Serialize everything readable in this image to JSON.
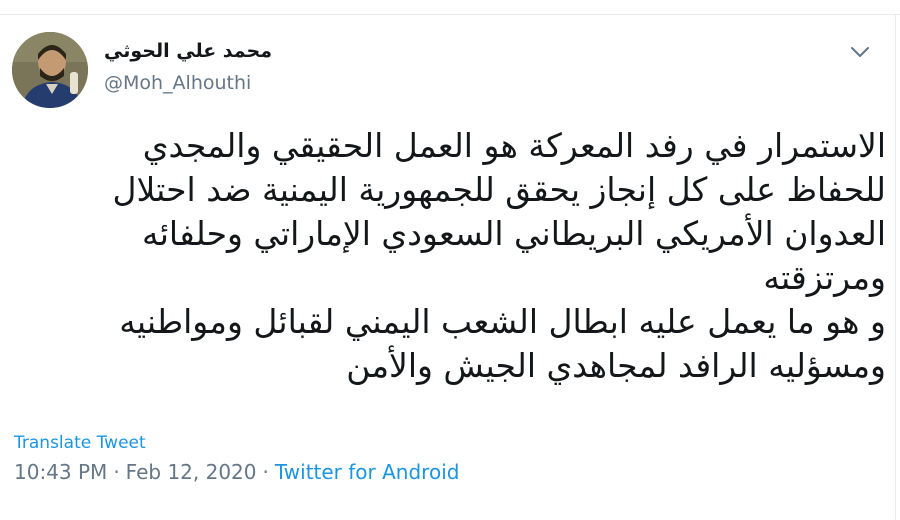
{
  "tweet": {
    "author": {
      "display_name": "محمد علي الحوثي",
      "handle": "@Moh_Alhouthi"
    },
    "text_lines": [
      "الاستمرار في رفد المعركة هو العمل الحقيقي والمجدي",
      "للحفاظ على كل إنجاز يحقق للجمهورية اليمنية ضد احتلال",
      "العدوان الأمريكي البريطاني السعودي الإماراتي وحلفائه",
      "ومرتزقته",
      "و هو ما يعمل عليه ابطال الشعب اليمني لقبائل ومواطنيه",
      "ومسؤليه الرافد لمجاهدي الجيش والأمن"
    ],
    "translate_label": "Translate Tweet",
    "time": "10:43 PM",
    "date": "Feb 12, 2020",
    "separator": "·",
    "source": "Twitter for Android"
  },
  "icons": {
    "menu": "chevron-down-icon",
    "avatar": "avatar"
  },
  "colors": {
    "text": "#14171a",
    "secondary": "#657786",
    "link": "#1b95e0",
    "border": "#e6ecf0"
  }
}
